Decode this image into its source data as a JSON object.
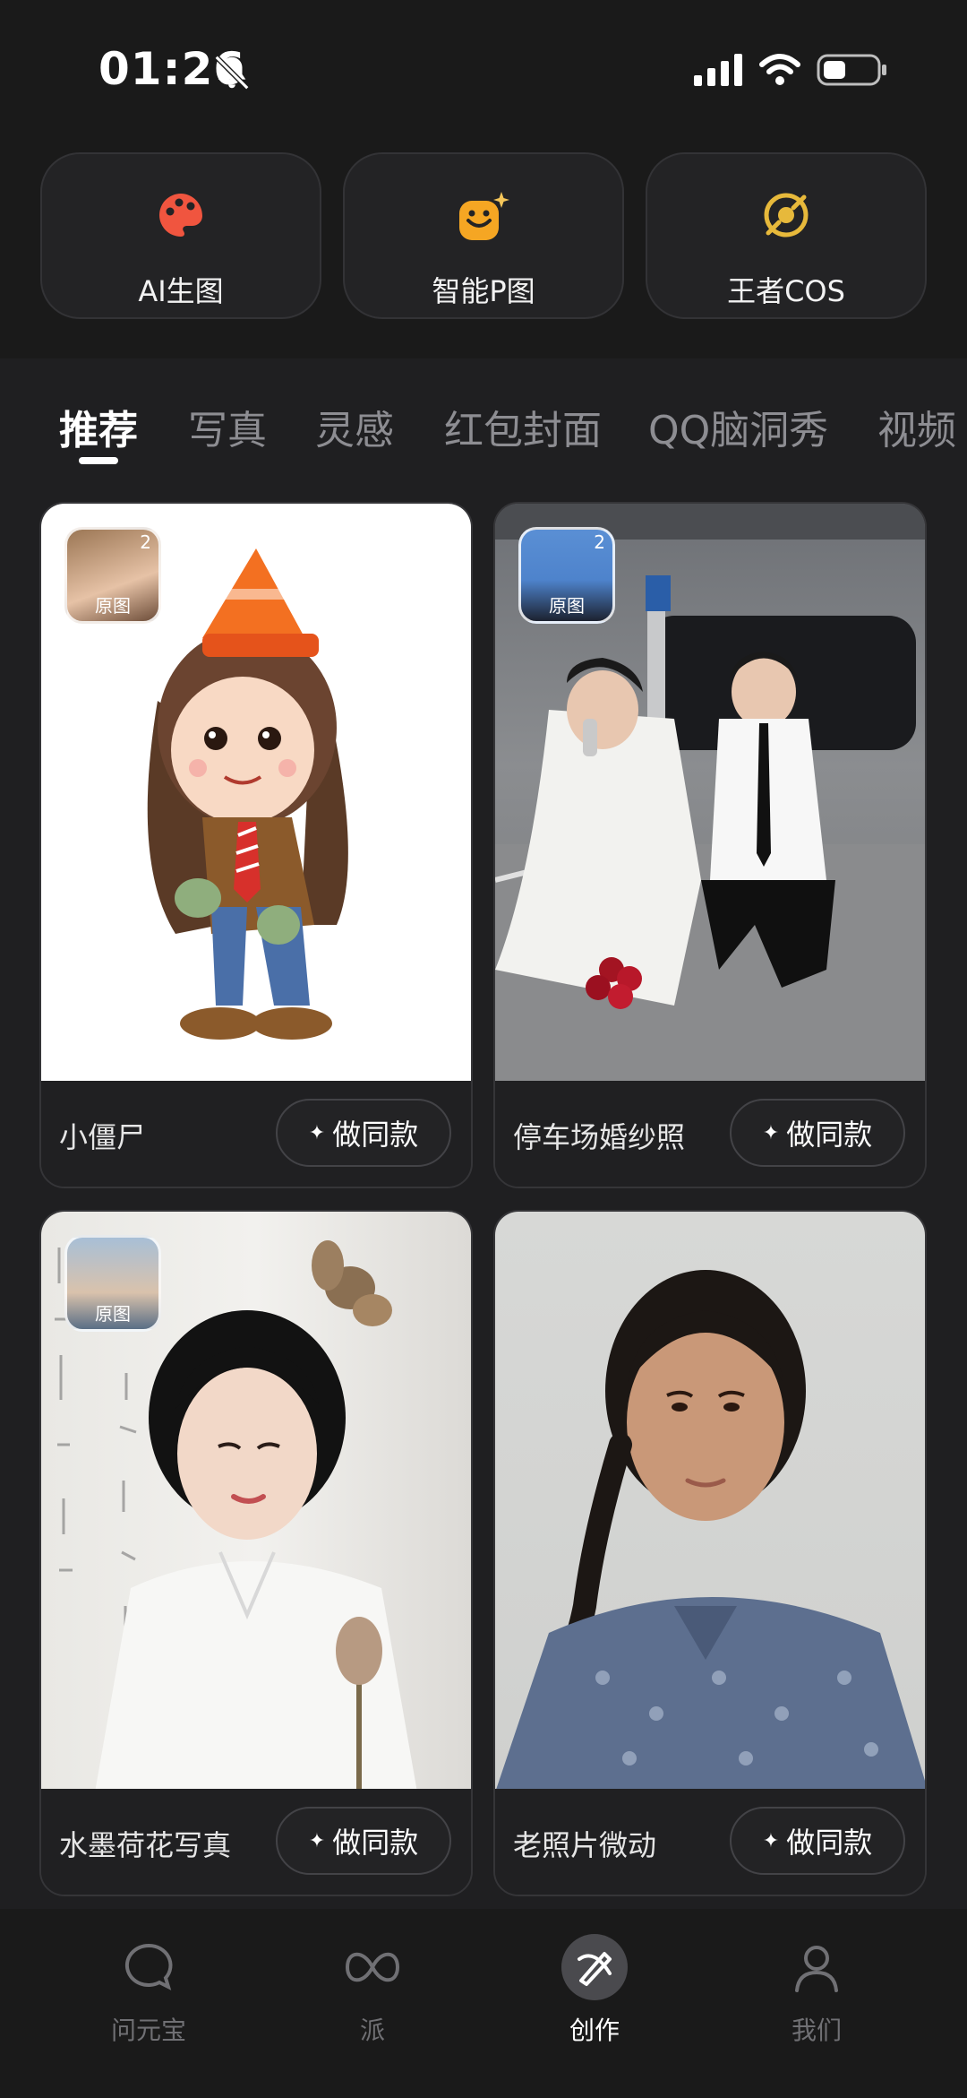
{
  "status_bar": {
    "time": "01:26",
    "icons": [
      "bell-muted-icon",
      "signal-icon",
      "wifi-icon",
      "battery-icon"
    ]
  },
  "tools": [
    {
      "label": "AI生图",
      "icon": "palette-icon",
      "color": "#f0553f"
    },
    {
      "label": "智能P图",
      "icon": "smile-sparkle-icon",
      "color": "#f5a623"
    },
    {
      "label": "王者COS",
      "icon": "target-icon",
      "color": "#e7b93b"
    }
  ],
  "tabs": [
    {
      "label": "推荐",
      "active": true
    },
    {
      "label": "写真",
      "active": false
    },
    {
      "label": "灵感",
      "active": false
    },
    {
      "label": "红包封面",
      "active": false
    },
    {
      "label": "QQ脑洞秀",
      "active": false
    },
    {
      "label": "视频",
      "active": false
    }
  ],
  "cards": [
    {
      "title": "小僵尸",
      "button": "做同款",
      "thumb_count": "2",
      "thumb_label": "原图"
    },
    {
      "title": "停车场婚纱照",
      "button": "做同款",
      "thumb_count": "2",
      "thumb_label": "原图"
    },
    {
      "title": "水墨荷花写真",
      "button": "做同款",
      "thumb_count": "",
      "thumb_label": "原图"
    },
    {
      "title": "老照片微动",
      "button": "做同款",
      "thumb_count": "",
      "thumb_label": ""
    }
  ],
  "bottom_nav": [
    {
      "label": "问元宝",
      "icon": "chat-bubble-icon",
      "active": false
    },
    {
      "label": "派",
      "icon": "infinity-icon",
      "active": false
    },
    {
      "label": "创作",
      "icon": "create-icon",
      "active": true
    },
    {
      "label": "我们",
      "icon": "person-icon",
      "active": false
    }
  ]
}
